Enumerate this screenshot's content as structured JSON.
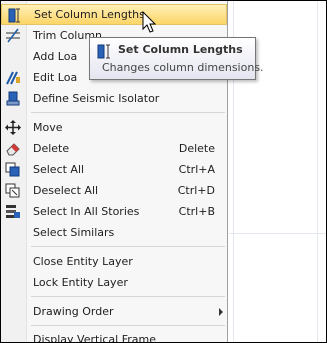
{
  "menu": {
    "items": [
      {
        "label": "Set Column Lengths",
        "shortcut": "",
        "icon": "column-length-icon"
      },
      {
        "label": "Trim Column",
        "shortcut": "",
        "icon": "trim-icon"
      },
      {
        "label": "Add Loa",
        "shortcut": "",
        "icon": ""
      },
      {
        "label": "Edit Loa",
        "shortcut": "",
        "icon": "edit-load-icon"
      },
      {
        "label": "Define Seismic Isolator",
        "shortcut": "",
        "icon": "isolator-icon"
      },
      {
        "label": "Move",
        "shortcut": "",
        "icon": "move-icon"
      },
      {
        "label": "Delete",
        "shortcut": "Delete",
        "icon": "eraser-icon"
      },
      {
        "label": "Select All",
        "shortcut": "Ctrl+A",
        "icon": "select-all-icon"
      },
      {
        "label": "Deselect All",
        "shortcut": "Ctrl+D",
        "icon": "deselect-all-icon"
      },
      {
        "label": "Select In All Stories",
        "shortcut": "Ctrl+B",
        "icon": "select-stories-icon"
      },
      {
        "label": "Select Similars",
        "shortcut": "",
        "icon": ""
      },
      {
        "label": "Close Entity Layer",
        "shortcut": "",
        "icon": ""
      },
      {
        "label": "Lock Entity Layer",
        "shortcut": "",
        "icon": ""
      },
      {
        "label": "Drawing Order",
        "shortcut": "",
        "icon": ""
      },
      {
        "label": "Display Vertical Frame",
        "shortcut": "",
        "icon": ""
      }
    ]
  },
  "tooltip": {
    "title": "Set Column Lengths",
    "description": "Changes column dimensions."
  },
  "colors": {
    "highlight": "#fdd983",
    "accent": "#1f5aa6"
  }
}
